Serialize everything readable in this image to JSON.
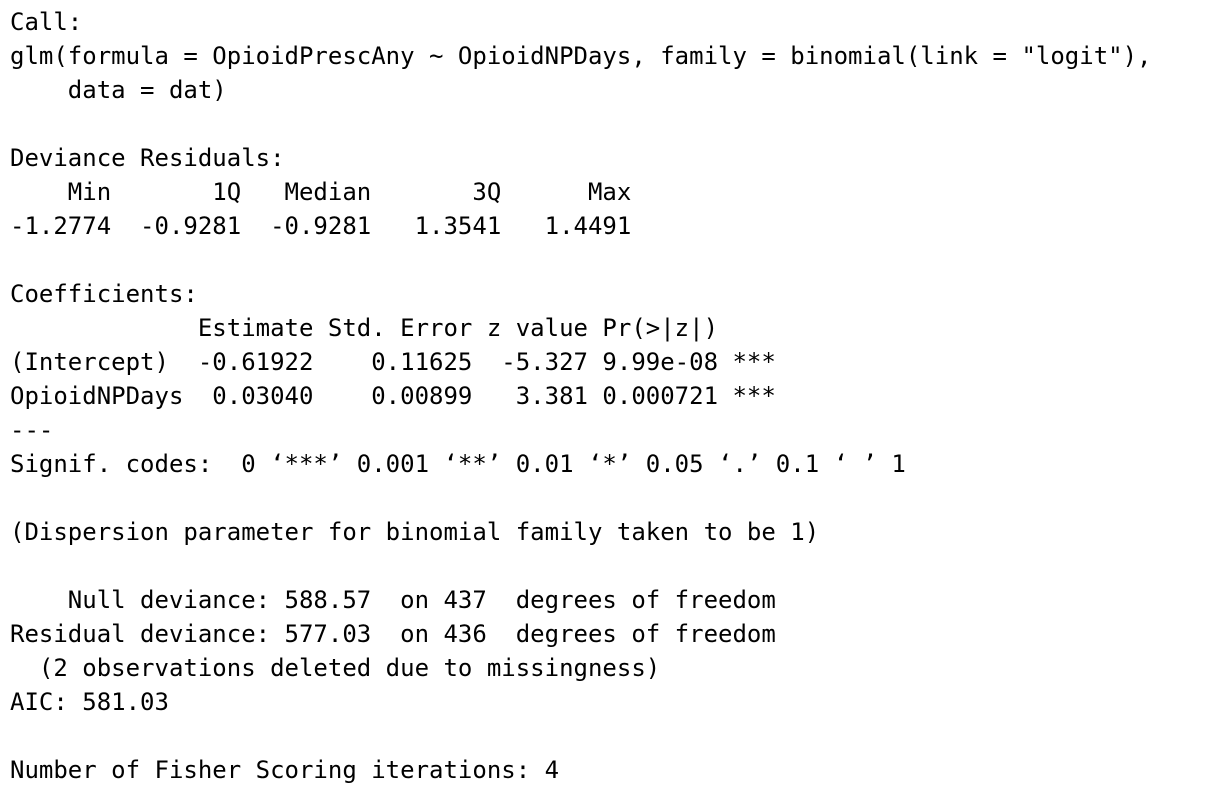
{
  "output": {
    "lines": [
      "Call:",
      "glm(formula = OpioidPrescAny ~ OpioidNPDays, family = binomial(link = \"logit\"),",
      "    data = dat)",
      "",
      "Deviance Residuals:",
      "    Min       1Q   Median       3Q      Max",
      "-1.2774  -0.9281  -0.9281   1.3541   1.4491",
      "",
      "Coefficients:",
      "             Estimate Std. Error z value Pr(>|z|)",
      "(Intercept)  -0.61922    0.11625  -5.327 9.99e-08 ***",
      "OpioidNPDays  0.03040    0.00899   3.381 0.000721 ***",
      "---",
      "Signif. codes:  0 ‘***’ 0.001 ‘**’ 0.01 ‘*’ 0.05 ‘.’ 0.1 ‘ ’ 1",
      "",
      "(Dispersion parameter for binomial family taken to be 1)",
      "",
      "    Null deviance: 588.57  on 437  degrees of freedom",
      "Residual deviance: 577.03  on 436  degrees of freedom",
      "  (2 observations deleted due to missingness)",
      "AIC: 581.03",
      "",
      "Number of Fisher Scoring iterations: 4"
    ]
  }
}
